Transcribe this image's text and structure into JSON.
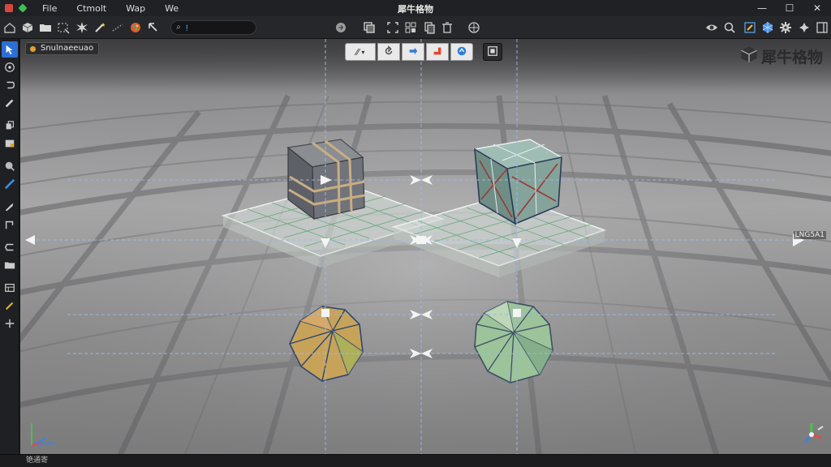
{
  "app": {
    "title": "犀牛格物",
    "menu": [
      "File",
      "Ctmolt",
      "Wap",
      "We"
    ],
    "accent": "#2c6fd6"
  },
  "toolbar": {
    "search_value": "ᴉ"
  },
  "viewport": {
    "label": "Snulnaeeuao",
    "brand_text": "犀牛格物",
    "edge_tag": "LNG5A1",
    "axis_label": "ꭓyANS",
    "toolbar": {
      "dropdown_label": "⁄⁄",
      "icons": [
        "rotate-icon",
        "redo-icon",
        "snap-icon",
        "refresh-icon",
        "layout-icon"
      ]
    }
  },
  "statusbar": {
    "text": "铯通寄"
  }
}
